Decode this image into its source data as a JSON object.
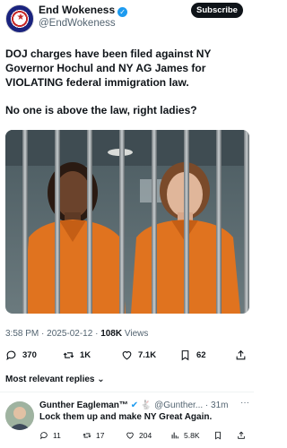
{
  "author": {
    "display_name": "End Wokeness",
    "handle": "@EndWokeness",
    "subscribe_label": "Subscribe"
  },
  "tweet": {
    "paragraphs": [
      "DOJ charges have been filed against NY Governor Hochul and NY AG James for VIOLATING federal immigration law.",
      "No one is above the law, right ladies?"
    ],
    "time": "3:58 PM",
    "date": "2025-02-12",
    "views_count": "108K",
    "views_label": "Views"
  },
  "actions": {
    "replies": "370",
    "reposts": "1K",
    "likes": "7.1K",
    "bookmarks": "62"
  },
  "replies_sort_label": "Most relevant replies",
  "reply": {
    "name": "Gunther Eagleman™",
    "badges": "✔ 🐇",
    "handle": "@Gunther...",
    "time": "31m",
    "text": "Lock them up and make NY Great Again.",
    "replies": "11",
    "reposts": "17",
    "likes": "204",
    "views": "5.8K"
  },
  "colors": {
    "verified_blue": "#1d9bf0",
    "muted_text": "#536471",
    "jumpsuit_orange": "#e0731f"
  }
}
